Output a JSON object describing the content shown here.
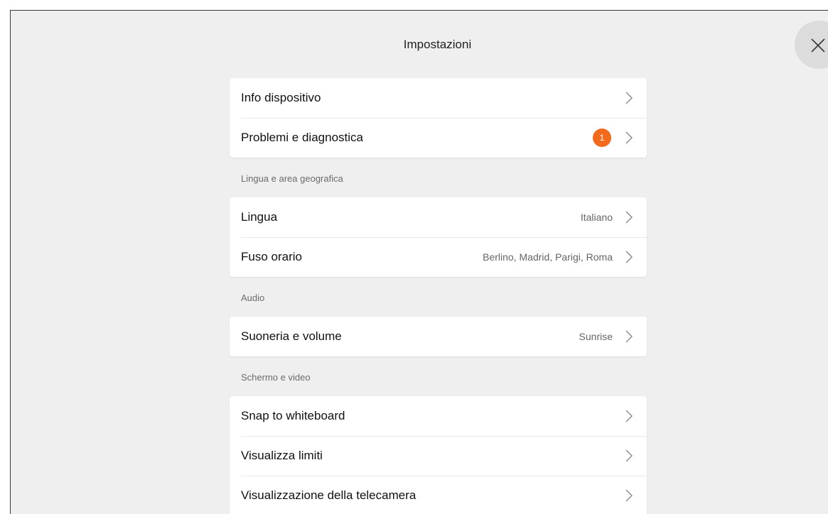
{
  "header": {
    "title": "Impostazioni",
    "close_icon": "close-icon"
  },
  "colors": {
    "background": "#efefef",
    "card": "#ffffff",
    "badge": "#f26b1d"
  },
  "groups": {
    "device": {
      "items": [
        {
          "label": "Info dispositivo",
          "icon": "chevron-right-icon"
        },
        {
          "label": "Problemi e diagnostica",
          "badge": "1",
          "icon": "chevron-right-icon"
        }
      ]
    },
    "language": {
      "header": "Lingua e area geografica",
      "items": [
        {
          "label": "Lingua",
          "value": "Italiano",
          "icon": "chevron-right-icon"
        },
        {
          "label": "Fuso orario",
          "value": "Berlino, Madrid, Parigi, Roma",
          "icon": "chevron-right-icon"
        }
      ]
    },
    "audio": {
      "header": "Audio",
      "items": [
        {
          "label": "Suoneria e volume",
          "value": "Sunrise",
          "icon": "chevron-right-icon"
        }
      ]
    },
    "display": {
      "header": "Schermo e video",
      "items": [
        {
          "label": "Snap to whiteboard",
          "icon": "chevron-right-icon"
        },
        {
          "label": "Visualizza limiti",
          "icon": "chevron-right-icon"
        },
        {
          "label": "Visualizzazione della telecamera",
          "icon": "chevron-right-icon"
        }
      ]
    }
  }
}
